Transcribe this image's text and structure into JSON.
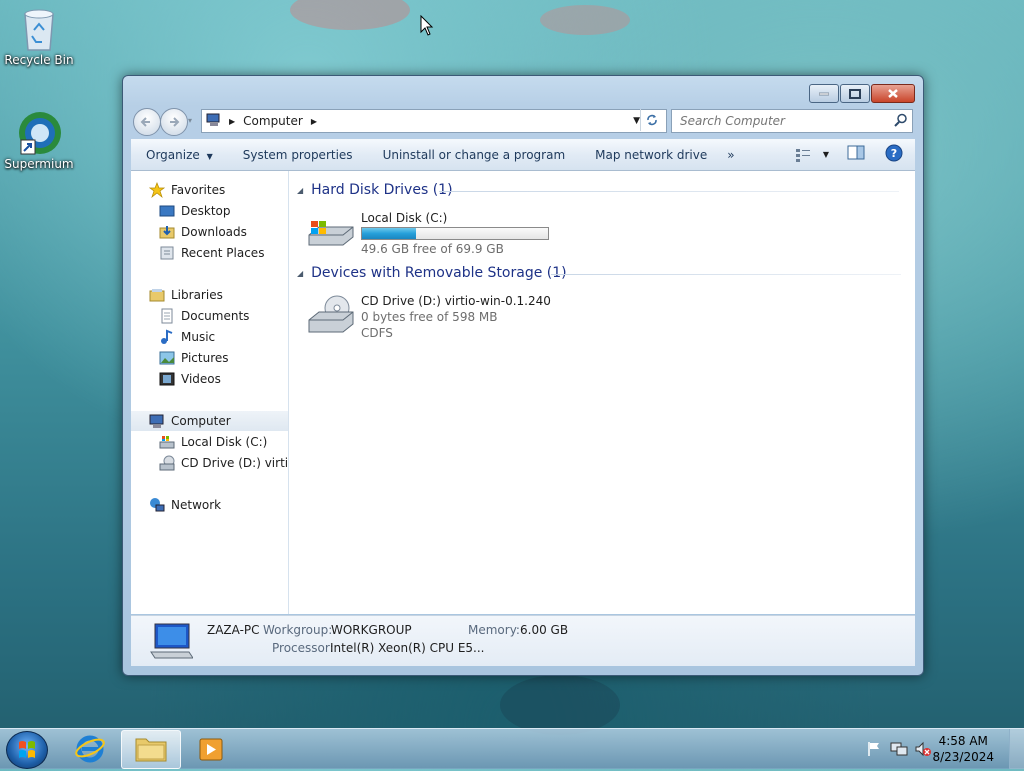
{
  "desktop": {
    "icons": [
      {
        "label": "Recycle Bin",
        "icon": "recycle-bin-icon"
      },
      {
        "label": "Supermium",
        "icon": "browser-icon"
      }
    ]
  },
  "window": {
    "address": {
      "segments": [
        "Computer"
      ]
    },
    "search": {
      "placeholder": "Search Computer"
    },
    "toolbar": {
      "organize": "Organize",
      "system_properties": "System properties",
      "uninstall": "Uninstall or change a program",
      "map_drive": "Map network drive",
      "more": "»"
    },
    "nav": {
      "favorites": "Favorites",
      "desktop": "Desktop",
      "downloads": "Downloads",
      "recent": "Recent Places",
      "libraries": "Libraries",
      "documents": "Documents",
      "music": "Music",
      "pictures": "Pictures",
      "videos": "Videos",
      "computer": "Computer",
      "local_disk": "Local Disk (C:)",
      "cd_drive": "CD Drive (D:) virtio-w",
      "network": "Network"
    },
    "groups": {
      "hdd": "Hard Disk Drives (1)",
      "removable": "Devices with Removable Storage (1)"
    },
    "drives": {
      "c": {
        "name": "Local Disk (C:)",
        "free": "49.6 GB free of 69.9 GB",
        "used_fraction": 0.29
      },
      "d": {
        "name": "CD Drive (D:) virtio-win-0.1.240",
        "free": "0 bytes free of 598 MB",
        "fs": "CDFS"
      }
    },
    "details": {
      "pc_name": "ZAZA-PC",
      "workgroup_label": "Workgroup:",
      "workgroup": "WORKGROUP",
      "memory_label": "Memory:",
      "memory": "6.00 GB",
      "processor_label": "Processor:",
      "processor": "Intel(R) Xeon(R) CPU E5..."
    }
  },
  "taskbar": {
    "time": "4:58 AM",
    "date": "8/23/2024"
  }
}
